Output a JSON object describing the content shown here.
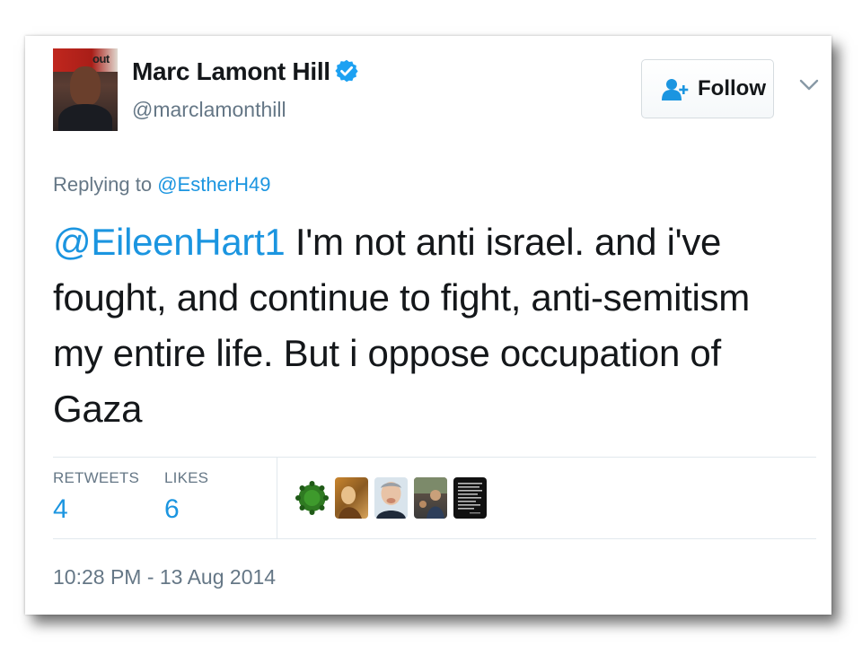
{
  "user": {
    "name": "Marc Lamont Hill",
    "handle": "@marclamonthill",
    "avatar_text": "out"
  },
  "follow_button": {
    "label": "Follow",
    "icon": "add-user-icon"
  },
  "reply": {
    "prefix": "Replying to",
    "to": "@EstherH49"
  },
  "tweet": {
    "mention": "@EileenHart1",
    "text": " I'm not anti israel. and i've fought, and continue to fight, anti-semitism my entire life. But i oppose occupation of Gaza"
  },
  "stats": {
    "retweets_label": "RETWEETS",
    "retweets_value": "4",
    "likes_label": "LIKES",
    "likes_value": "6"
  },
  "timestamp": "10:28 PM - 13 Aug 2014",
  "colors": {
    "link_blue": "#1b95e0",
    "verified_blue": "#1da1f2",
    "text_dark": "#14171a",
    "text_gray": "#657786"
  }
}
